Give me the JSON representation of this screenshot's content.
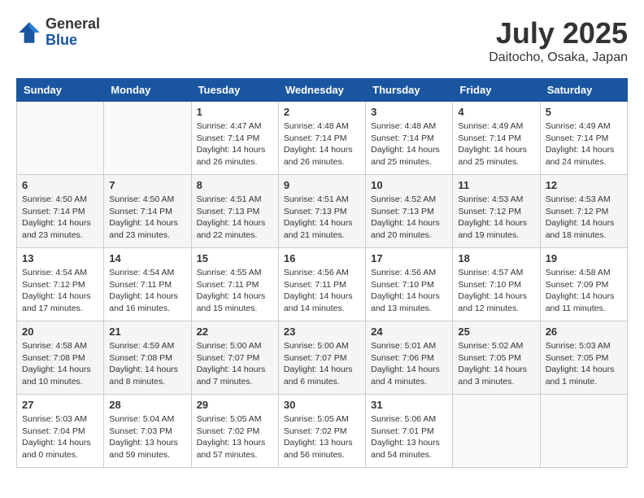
{
  "header": {
    "logo_general": "General",
    "logo_blue": "Blue",
    "month_title": "July 2025",
    "location": "Daitocho, Osaka, Japan"
  },
  "weekdays": [
    "Sunday",
    "Monday",
    "Tuesday",
    "Wednesday",
    "Thursday",
    "Friday",
    "Saturday"
  ],
  "weeks": [
    [
      {
        "day": "",
        "info": ""
      },
      {
        "day": "",
        "info": ""
      },
      {
        "day": "1",
        "info": "Sunrise: 4:47 AM\nSunset: 7:14 PM\nDaylight: 14 hours and 26 minutes."
      },
      {
        "day": "2",
        "info": "Sunrise: 4:48 AM\nSunset: 7:14 PM\nDaylight: 14 hours and 26 minutes."
      },
      {
        "day": "3",
        "info": "Sunrise: 4:48 AM\nSunset: 7:14 PM\nDaylight: 14 hours and 25 minutes."
      },
      {
        "day": "4",
        "info": "Sunrise: 4:49 AM\nSunset: 7:14 PM\nDaylight: 14 hours and 25 minutes."
      },
      {
        "day": "5",
        "info": "Sunrise: 4:49 AM\nSunset: 7:14 PM\nDaylight: 14 hours and 24 minutes."
      }
    ],
    [
      {
        "day": "6",
        "info": "Sunrise: 4:50 AM\nSunset: 7:14 PM\nDaylight: 14 hours and 23 minutes."
      },
      {
        "day": "7",
        "info": "Sunrise: 4:50 AM\nSunset: 7:14 PM\nDaylight: 14 hours and 23 minutes."
      },
      {
        "day": "8",
        "info": "Sunrise: 4:51 AM\nSunset: 7:13 PM\nDaylight: 14 hours and 22 minutes."
      },
      {
        "day": "9",
        "info": "Sunrise: 4:51 AM\nSunset: 7:13 PM\nDaylight: 14 hours and 21 minutes."
      },
      {
        "day": "10",
        "info": "Sunrise: 4:52 AM\nSunset: 7:13 PM\nDaylight: 14 hours and 20 minutes."
      },
      {
        "day": "11",
        "info": "Sunrise: 4:53 AM\nSunset: 7:12 PM\nDaylight: 14 hours and 19 minutes."
      },
      {
        "day": "12",
        "info": "Sunrise: 4:53 AM\nSunset: 7:12 PM\nDaylight: 14 hours and 18 minutes."
      }
    ],
    [
      {
        "day": "13",
        "info": "Sunrise: 4:54 AM\nSunset: 7:12 PM\nDaylight: 14 hours and 17 minutes."
      },
      {
        "day": "14",
        "info": "Sunrise: 4:54 AM\nSunset: 7:11 PM\nDaylight: 14 hours and 16 minutes."
      },
      {
        "day": "15",
        "info": "Sunrise: 4:55 AM\nSunset: 7:11 PM\nDaylight: 14 hours and 15 minutes."
      },
      {
        "day": "16",
        "info": "Sunrise: 4:56 AM\nSunset: 7:11 PM\nDaylight: 14 hours and 14 minutes."
      },
      {
        "day": "17",
        "info": "Sunrise: 4:56 AM\nSunset: 7:10 PM\nDaylight: 14 hours and 13 minutes."
      },
      {
        "day": "18",
        "info": "Sunrise: 4:57 AM\nSunset: 7:10 PM\nDaylight: 14 hours and 12 minutes."
      },
      {
        "day": "19",
        "info": "Sunrise: 4:58 AM\nSunset: 7:09 PM\nDaylight: 14 hours and 11 minutes."
      }
    ],
    [
      {
        "day": "20",
        "info": "Sunrise: 4:58 AM\nSunset: 7:08 PM\nDaylight: 14 hours and 10 minutes."
      },
      {
        "day": "21",
        "info": "Sunrise: 4:59 AM\nSunset: 7:08 PM\nDaylight: 14 hours and 8 minutes."
      },
      {
        "day": "22",
        "info": "Sunrise: 5:00 AM\nSunset: 7:07 PM\nDaylight: 14 hours and 7 minutes."
      },
      {
        "day": "23",
        "info": "Sunrise: 5:00 AM\nSunset: 7:07 PM\nDaylight: 14 hours and 6 minutes."
      },
      {
        "day": "24",
        "info": "Sunrise: 5:01 AM\nSunset: 7:06 PM\nDaylight: 14 hours and 4 minutes."
      },
      {
        "day": "25",
        "info": "Sunrise: 5:02 AM\nSunset: 7:05 PM\nDaylight: 14 hours and 3 minutes."
      },
      {
        "day": "26",
        "info": "Sunrise: 5:03 AM\nSunset: 7:05 PM\nDaylight: 14 hours and 1 minute."
      }
    ],
    [
      {
        "day": "27",
        "info": "Sunrise: 5:03 AM\nSunset: 7:04 PM\nDaylight: 14 hours and 0 minutes."
      },
      {
        "day": "28",
        "info": "Sunrise: 5:04 AM\nSunset: 7:03 PM\nDaylight: 13 hours and 59 minutes."
      },
      {
        "day": "29",
        "info": "Sunrise: 5:05 AM\nSunset: 7:02 PM\nDaylight: 13 hours and 57 minutes."
      },
      {
        "day": "30",
        "info": "Sunrise: 5:05 AM\nSunset: 7:02 PM\nDaylight: 13 hours and 56 minutes."
      },
      {
        "day": "31",
        "info": "Sunrise: 5:06 AM\nSunset: 7:01 PM\nDaylight: 13 hours and 54 minutes."
      },
      {
        "day": "",
        "info": ""
      },
      {
        "day": "",
        "info": ""
      }
    ]
  ]
}
